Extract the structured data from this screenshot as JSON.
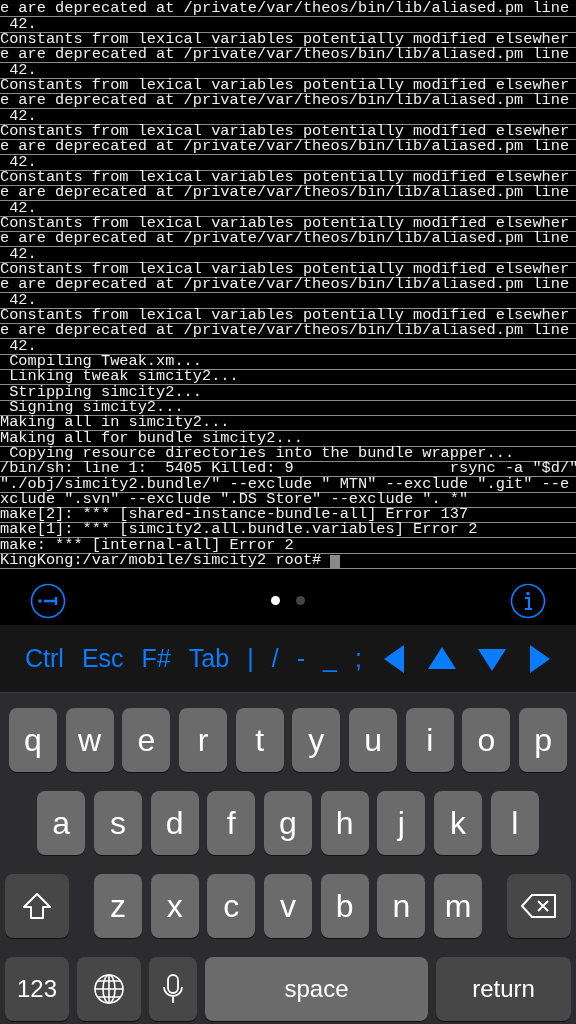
{
  "terminal": {
    "lines": [
      "e are deprecated at /private/var/theos/bin/lib/aliased.pm line",
      " 42.",
      "Constants from lexical variables potentially modified elsewher",
      "e are deprecated at /private/var/theos/bin/lib/aliased.pm line",
      " 42.",
      "Constants from lexical variables potentially modified elsewher",
      "e are deprecated at /private/var/theos/bin/lib/aliased.pm line",
      " 42.",
      "Constants from lexical variables potentially modified elsewher",
      "e are deprecated at /private/var/theos/bin/lib/aliased.pm line",
      " 42.",
      "Constants from lexical variables potentially modified elsewher",
      "e are deprecated at /private/var/theos/bin/lib/aliased.pm line",
      " 42.",
      "Constants from lexical variables potentially modified elsewher",
      "e are deprecated at /private/var/theos/bin/lib/aliased.pm line",
      " 42.",
      "Constants from lexical variables potentially modified elsewher",
      "e are deprecated at /private/var/theos/bin/lib/aliased.pm line",
      " 42.",
      "Constants from lexical variables potentially modified elsewher",
      "e are deprecated at /private/var/theos/bin/lib/aliased.pm line",
      " 42.",
      " Compiling Tweak.xm...",
      " Linking tweak simcity2...",
      " Stripping simcity2...",
      " Signing simcity2...",
      "Making all in simcity2...",
      "Making all for bundle simcity2...",
      " Copying resource directories into the bundle wrapper...",
      "/bin/sh: line 1:  5405 Killed: 9                 rsync -a \"$d/\"",
      "\"./obj/simcity2.bundle/\" --exclude \" MTN\" --exclude \".git\" --e",
      "xclude \".svn\" --exclude \".DS Store\" --exclude \". *\"",
      "make[2]: *** [shared-instance-bundle-all] Error 137",
      "make[1]: *** [simcity2.all.bundle.variables] Error 2",
      "make: *** [internal-all] Error 2",
      "KingKong:/var/mobile/simcity2 root# "
    ],
    "cursor_visible": true
  },
  "page_dots": [
    {
      "selected": true
    },
    {
      "selected": false
    }
  ],
  "extra_keys": [
    {
      "kind": "text",
      "label": "Ctrl"
    },
    {
      "kind": "text",
      "label": "Esc"
    },
    {
      "kind": "text",
      "label": "F#"
    },
    {
      "kind": "text",
      "label": "Tab"
    },
    {
      "kind": "text",
      "label": "|"
    },
    {
      "kind": "text",
      "label": "/"
    },
    {
      "kind": "text",
      "label": "-"
    },
    {
      "kind": "text",
      "label": "_"
    },
    {
      "kind": "text",
      "label": ";"
    },
    {
      "kind": "left"
    },
    {
      "kind": "up"
    },
    {
      "kind": "down"
    },
    {
      "kind": "right"
    }
  ],
  "keyboard": {
    "rows": [
      {
        "keys": [
          {
            "kind": "letter",
            "label": "q"
          },
          {
            "kind": "letter",
            "label": "w"
          },
          {
            "kind": "letter",
            "label": "e"
          },
          {
            "kind": "letter",
            "label": "r"
          },
          {
            "kind": "letter",
            "label": "t"
          },
          {
            "kind": "letter",
            "label": "y"
          },
          {
            "kind": "letter",
            "label": "u"
          },
          {
            "kind": "letter",
            "label": "i"
          },
          {
            "kind": "letter",
            "label": "o"
          },
          {
            "kind": "letter",
            "label": "p"
          }
        ]
      },
      {
        "keys": [
          {
            "kind": "letter",
            "label": "a"
          },
          {
            "kind": "letter",
            "label": "s"
          },
          {
            "kind": "letter",
            "label": "d"
          },
          {
            "kind": "letter",
            "label": "f"
          },
          {
            "kind": "letter",
            "label": "g"
          },
          {
            "kind": "letter",
            "label": "h"
          },
          {
            "kind": "letter",
            "label": "j"
          },
          {
            "kind": "letter",
            "label": "k"
          },
          {
            "kind": "letter",
            "label": "l"
          }
        ]
      },
      {
        "keys": [
          {
            "kind": "shift"
          },
          {
            "kind": "letter",
            "label": "z"
          },
          {
            "kind": "letter",
            "label": "x"
          },
          {
            "kind": "letter",
            "label": "c"
          },
          {
            "kind": "letter",
            "label": "v"
          },
          {
            "kind": "letter",
            "label": "b"
          },
          {
            "kind": "letter",
            "label": "n"
          },
          {
            "kind": "letter",
            "label": "m"
          },
          {
            "kind": "backspace"
          }
        ]
      },
      {
        "keys": [
          {
            "kind": "mode",
            "label": "123"
          },
          {
            "kind": "globe"
          },
          {
            "kind": "mic"
          },
          {
            "kind": "space",
            "label": "space"
          },
          {
            "kind": "return",
            "label": "return"
          }
        ]
      }
    ]
  }
}
